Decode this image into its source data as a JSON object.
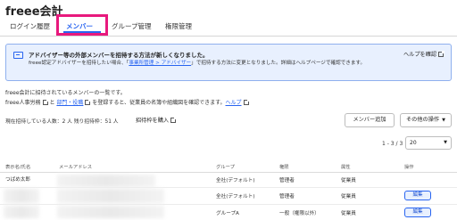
{
  "app": {
    "title": "freee会計"
  },
  "tabs": [
    {
      "label": "ログイン履歴",
      "active": false
    },
    {
      "label": "メンバー",
      "active": true
    },
    {
      "label": "グループ管理",
      "active": false
    },
    {
      "label": "権限管理",
      "active": false
    }
  ],
  "notice": {
    "title": "アドバイザー等の外部メンバーを招待する方法が新しくなりました。",
    "body_before": "freee認定アドバイザーを招待したい場合、「",
    "body_link": "事業所管理 > アドバイザー",
    "body_after": "」で招待する方法に変更となりました。詳細はヘルプページで確認できます。",
    "help_label": "ヘルプを確認"
  },
  "description": {
    "line1": "freee会計に招待されているメンバーの一覧です。",
    "line2_prefix": "freee人事労務",
    "line2_sep": "と",
    "line2_link": "部門・役職",
    "line2_suffix": "を登録すると、従業員の名簿や組織図を確認できます。",
    "line2_help": "ヘルプ"
  },
  "summary": {
    "counts": "現在招待している人数：2 人 残り招待枠：51 人",
    "buy_label": "招待枠を購入"
  },
  "actions": {
    "add_member": "メンバー追加",
    "other_ops": "その他の操作"
  },
  "pagination": {
    "range": "1 - 3 / 3",
    "per_page": "20"
  },
  "table": {
    "headers": [
      "表示名/氏名",
      "メールアドレス",
      "グループ",
      "権限",
      "属性",
      "操作"
    ],
    "rows": [
      {
        "name": "つばめ太郎",
        "group": "全社(デフォルト)",
        "role": "管理者",
        "attr": "従業員",
        "action": ""
      },
      {
        "name": "",
        "group": "全社(デフォルト)",
        "role": "管理者",
        "attr": "従業員",
        "action": "編集"
      },
      {
        "name": "",
        "group": "グループA",
        "role": "一般（権限以外）",
        "attr": "従業員",
        "action": "編集"
      }
    ]
  },
  "colors": {
    "accent": "#2864f0",
    "highlight": "#e8197d",
    "notice_bg": "#e8f0fe"
  }
}
